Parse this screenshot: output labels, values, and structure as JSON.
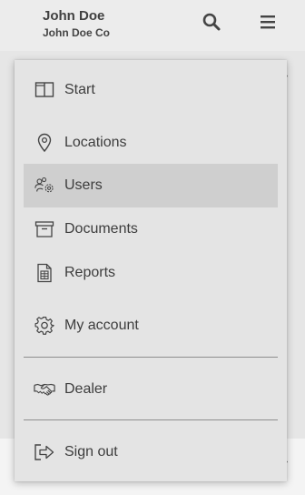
{
  "header": {
    "user_name": "John Doe",
    "company_name": "John Doe Co",
    "search_icon": "search-icon",
    "menu_icon": "hamburger-menu-icon"
  },
  "menu": {
    "items": [
      {
        "label": "Start",
        "icon": "layout-columns-icon",
        "active": false
      },
      {
        "label": "Locations",
        "icon": "location-pin-icon",
        "active": false
      },
      {
        "label": "Users",
        "icon": "users-gear-icon",
        "active": true
      },
      {
        "label": "Documents",
        "icon": "archive-box-icon",
        "active": false
      },
      {
        "label": "Reports",
        "icon": "report-spreadsheet-icon",
        "active": false
      },
      {
        "label": "My account",
        "icon": "gear-icon",
        "active": false
      },
      {
        "label": "Dealer",
        "icon": "handshake-icon",
        "active": false
      },
      {
        "label": "Sign out",
        "icon": "sign-out-icon",
        "active": false
      }
    ]
  },
  "colors": {
    "active_item_bg": "#cfcfcf",
    "panel_bg": "#e4e4e4",
    "text": "#3d3d3d"
  }
}
